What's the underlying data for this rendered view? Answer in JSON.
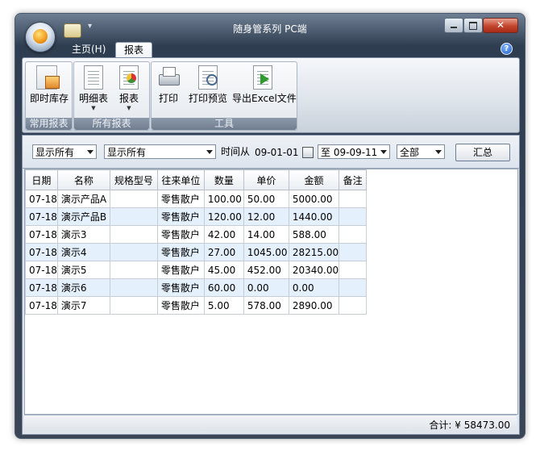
{
  "window": {
    "title": "随身管系列 PC端"
  },
  "tabs": [
    {
      "label": "主页(H)"
    },
    {
      "label": "报表"
    }
  ],
  "ribbon": {
    "groups": [
      {
        "label": "常用报表",
        "buttons": [
          {
            "label": "即时库存",
            "icon": "inventory-box-icon"
          }
        ]
      },
      {
        "label": "所有报表",
        "buttons": [
          {
            "label": "明细表",
            "icon": "detail-sheet-icon"
          },
          {
            "label": "报表",
            "icon": "pie-report-icon"
          }
        ]
      },
      {
        "label": "工具",
        "buttons": [
          {
            "label": "打印",
            "icon": "printer-icon"
          },
          {
            "label": "打印预览",
            "icon": "print-preview-icon"
          },
          {
            "label": "导出Excel文件",
            "icon": "export-excel-icon"
          }
        ]
      }
    ]
  },
  "filter": {
    "select1": "显示所有",
    "select2": "显示所有",
    "time_from_label": "时间从",
    "date_from": "09-01-01",
    "to_label": "至",
    "date_to": "09-09-11",
    "scope": "全部",
    "sum_button": "汇总"
  },
  "table": {
    "columns": [
      "日期",
      "名称",
      "规格型号",
      "往来单位",
      "数量",
      "单价",
      "金额",
      "备注"
    ],
    "rows": [
      [
        "07-18",
        "演示产品A",
        "",
        "零售散户",
        "100.00",
        "50.00",
        "5000.00",
        ""
      ],
      [
        "07-18",
        "演示产品B",
        "",
        "零售散户",
        "120.00",
        "12.00",
        "1440.00",
        ""
      ],
      [
        "07-18",
        "演示3",
        "",
        "零售散户",
        "42.00",
        "14.00",
        "588.00",
        ""
      ],
      [
        "07-18",
        "演示4",
        "",
        "零售散户",
        "27.00",
        "1045.00",
        "28215.00",
        ""
      ],
      [
        "07-18",
        "演示5",
        "",
        "零售散户",
        "45.00",
        "452.00",
        "20340.00",
        ""
      ],
      [
        "07-18",
        "演示6",
        "",
        "零售散户",
        "60.00",
        "0.00",
        "0.00",
        ""
      ],
      [
        "07-18",
        "演示7",
        "",
        "零售散户",
        "5.00",
        "578.00",
        "2890.00",
        ""
      ]
    ]
  },
  "status": {
    "total_label": "合计: ¥ 58473.00"
  },
  "colors": {
    "row_alt": "#e4f0fb",
    "title_bar": "#2f3d50"
  }
}
